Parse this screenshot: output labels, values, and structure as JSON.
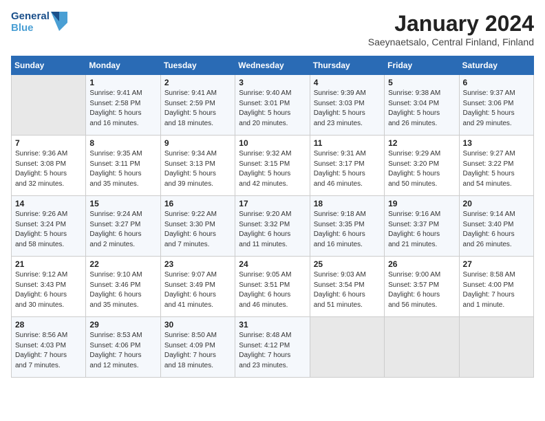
{
  "logo": {
    "line1": "General",
    "line2": "Blue"
  },
  "title": "January 2024",
  "location": "Saeynaetsalo, Central Finland, Finland",
  "headers": [
    "Sunday",
    "Monday",
    "Tuesday",
    "Wednesday",
    "Thursday",
    "Friday",
    "Saturday"
  ],
  "weeks": [
    [
      {
        "day": "",
        "info": ""
      },
      {
        "day": "1",
        "info": "Sunrise: 9:41 AM\nSunset: 2:58 PM\nDaylight: 5 hours\nand 16 minutes."
      },
      {
        "day": "2",
        "info": "Sunrise: 9:41 AM\nSunset: 2:59 PM\nDaylight: 5 hours\nand 18 minutes."
      },
      {
        "day": "3",
        "info": "Sunrise: 9:40 AM\nSunset: 3:01 PM\nDaylight: 5 hours\nand 20 minutes."
      },
      {
        "day": "4",
        "info": "Sunrise: 9:39 AM\nSunset: 3:03 PM\nDaylight: 5 hours\nand 23 minutes."
      },
      {
        "day": "5",
        "info": "Sunrise: 9:38 AM\nSunset: 3:04 PM\nDaylight: 5 hours\nand 26 minutes."
      },
      {
        "day": "6",
        "info": "Sunrise: 9:37 AM\nSunset: 3:06 PM\nDaylight: 5 hours\nand 29 minutes."
      }
    ],
    [
      {
        "day": "7",
        "info": "Sunrise: 9:36 AM\nSunset: 3:08 PM\nDaylight: 5 hours\nand 32 minutes."
      },
      {
        "day": "8",
        "info": "Sunrise: 9:35 AM\nSunset: 3:11 PM\nDaylight: 5 hours\nand 35 minutes."
      },
      {
        "day": "9",
        "info": "Sunrise: 9:34 AM\nSunset: 3:13 PM\nDaylight: 5 hours\nand 39 minutes."
      },
      {
        "day": "10",
        "info": "Sunrise: 9:32 AM\nSunset: 3:15 PM\nDaylight: 5 hours\nand 42 minutes."
      },
      {
        "day": "11",
        "info": "Sunrise: 9:31 AM\nSunset: 3:17 PM\nDaylight: 5 hours\nand 46 minutes."
      },
      {
        "day": "12",
        "info": "Sunrise: 9:29 AM\nSunset: 3:20 PM\nDaylight: 5 hours\nand 50 minutes."
      },
      {
        "day": "13",
        "info": "Sunrise: 9:27 AM\nSunset: 3:22 PM\nDaylight: 5 hours\nand 54 minutes."
      }
    ],
    [
      {
        "day": "14",
        "info": "Sunrise: 9:26 AM\nSunset: 3:24 PM\nDaylight: 5 hours\nand 58 minutes."
      },
      {
        "day": "15",
        "info": "Sunrise: 9:24 AM\nSunset: 3:27 PM\nDaylight: 6 hours\nand 2 minutes."
      },
      {
        "day": "16",
        "info": "Sunrise: 9:22 AM\nSunset: 3:30 PM\nDaylight: 6 hours\nand 7 minutes."
      },
      {
        "day": "17",
        "info": "Sunrise: 9:20 AM\nSunset: 3:32 PM\nDaylight: 6 hours\nand 11 minutes."
      },
      {
        "day": "18",
        "info": "Sunrise: 9:18 AM\nSunset: 3:35 PM\nDaylight: 6 hours\nand 16 minutes."
      },
      {
        "day": "19",
        "info": "Sunrise: 9:16 AM\nSunset: 3:37 PM\nDaylight: 6 hours\nand 21 minutes."
      },
      {
        "day": "20",
        "info": "Sunrise: 9:14 AM\nSunset: 3:40 PM\nDaylight: 6 hours\nand 26 minutes."
      }
    ],
    [
      {
        "day": "21",
        "info": "Sunrise: 9:12 AM\nSunset: 3:43 PM\nDaylight: 6 hours\nand 30 minutes."
      },
      {
        "day": "22",
        "info": "Sunrise: 9:10 AM\nSunset: 3:46 PM\nDaylight: 6 hours\nand 35 minutes."
      },
      {
        "day": "23",
        "info": "Sunrise: 9:07 AM\nSunset: 3:49 PM\nDaylight: 6 hours\nand 41 minutes."
      },
      {
        "day": "24",
        "info": "Sunrise: 9:05 AM\nSunset: 3:51 PM\nDaylight: 6 hours\nand 46 minutes."
      },
      {
        "day": "25",
        "info": "Sunrise: 9:03 AM\nSunset: 3:54 PM\nDaylight: 6 hours\nand 51 minutes."
      },
      {
        "day": "26",
        "info": "Sunrise: 9:00 AM\nSunset: 3:57 PM\nDaylight: 6 hours\nand 56 minutes."
      },
      {
        "day": "27",
        "info": "Sunrise: 8:58 AM\nSunset: 4:00 PM\nDaylight: 7 hours\nand 1 minute."
      }
    ],
    [
      {
        "day": "28",
        "info": "Sunrise: 8:56 AM\nSunset: 4:03 PM\nDaylight: 7 hours\nand 7 minutes."
      },
      {
        "day": "29",
        "info": "Sunrise: 8:53 AM\nSunset: 4:06 PM\nDaylight: 7 hours\nand 12 minutes."
      },
      {
        "day": "30",
        "info": "Sunrise: 8:50 AM\nSunset: 4:09 PM\nDaylight: 7 hours\nand 18 minutes."
      },
      {
        "day": "31",
        "info": "Sunrise: 8:48 AM\nSunset: 4:12 PM\nDaylight: 7 hours\nand 23 minutes."
      },
      {
        "day": "",
        "info": ""
      },
      {
        "day": "",
        "info": ""
      },
      {
        "day": "",
        "info": ""
      }
    ]
  ]
}
